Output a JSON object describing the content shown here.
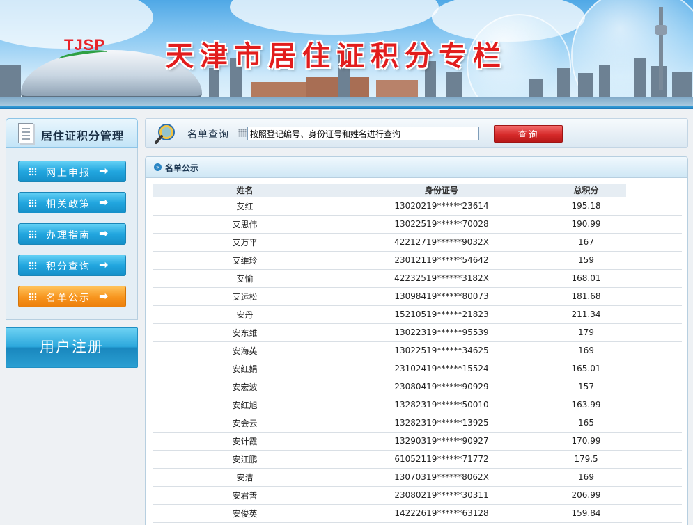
{
  "banner": {
    "logo": "TJSP",
    "title": "天津市居住证积分专栏"
  },
  "sidebar": {
    "title": "居住证积分管理",
    "items": [
      {
        "label": "网上申报",
        "active": false
      },
      {
        "label": "相关政策",
        "active": false
      },
      {
        "label": "办理指南",
        "active": false
      },
      {
        "label": "积分查询",
        "active": false
      },
      {
        "label": "名单公示",
        "active": true
      }
    ],
    "arrow": "➡",
    "register_label": "用户注册"
  },
  "search": {
    "label": "名单查询",
    "value": "按照登记编号、身份证号和姓名进行查询",
    "button_label": "查询"
  },
  "list": {
    "title": "名单公示",
    "columns": [
      "姓名",
      "身份证号",
      "总积分"
    ],
    "rows": [
      {
        "name": "艾红",
        "id": "13020219******23614",
        "score": "195.18"
      },
      {
        "name": "艾思伟",
        "id": "13022519******70028",
        "score": "190.99"
      },
      {
        "name": "艾万平",
        "id": "42212719******9032X",
        "score": "167"
      },
      {
        "name": "艾维玲",
        "id": "23012119******54642",
        "score": "159"
      },
      {
        "name": "艾愉",
        "id": "42232519******3182X",
        "score": "168.01"
      },
      {
        "name": "艾运松",
        "id": "13098419******80073",
        "score": "181.68"
      },
      {
        "name": "安丹",
        "id": "15210519******21823",
        "score": "211.34"
      },
      {
        "name": "安东维",
        "id": "13022319******95539",
        "score": "179"
      },
      {
        "name": "安海英",
        "id": "13022519******34625",
        "score": "169"
      },
      {
        "name": "安红娟",
        "id": "23102419******15524",
        "score": "165.01"
      },
      {
        "name": "安宏波",
        "id": "23080419******90929",
        "score": "157"
      },
      {
        "name": "安红旭",
        "id": "13282319******50010",
        "score": "163.99"
      },
      {
        "name": "安会云",
        "id": "13282319******13925",
        "score": "165"
      },
      {
        "name": "安计霞",
        "id": "13290319******90927",
        "score": "170.99"
      },
      {
        "name": "安江鹏",
        "id": "61052119******71772",
        "score": "179.5"
      },
      {
        "name": "安洁",
        "id": "13070319******8062X",
        "score": "169"
      },
      {
        "name": "安君善",
        "id": "23080219******30311",
        "score": "206.99"
      },
      {
        "name": "安俊英",
        "id": "14222619******63128",
        "score": "159.84"
      }
    ]
  }
}
